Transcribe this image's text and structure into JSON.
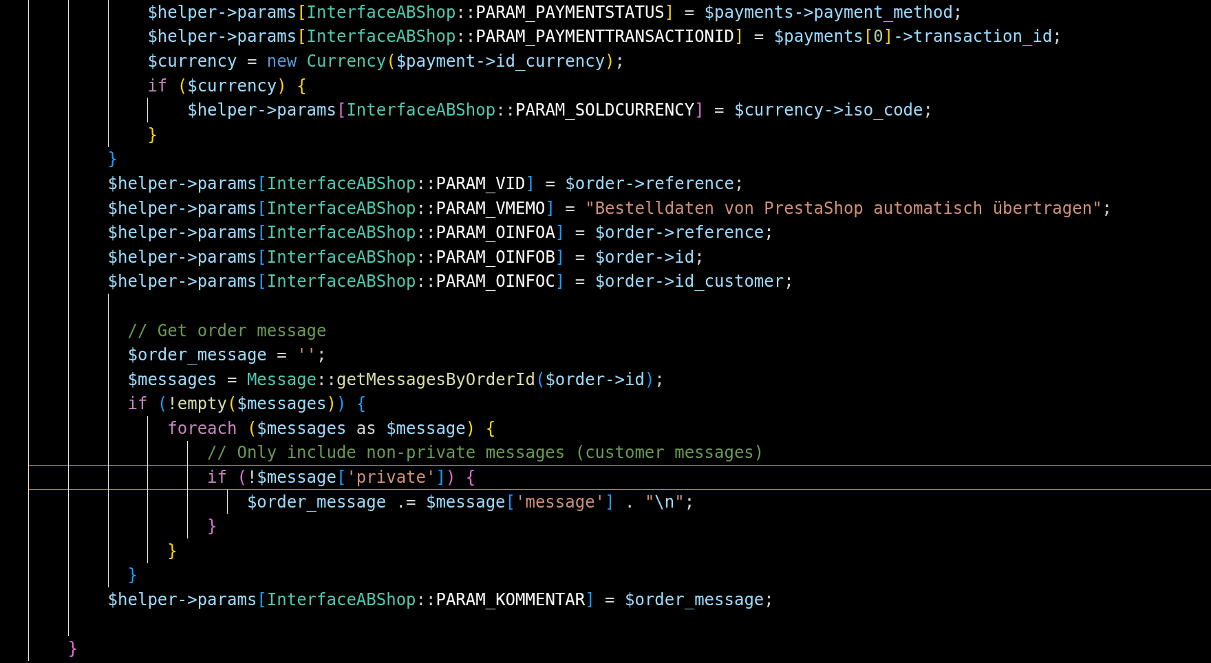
{
  "editor": {
    "lines": [
      {
        "kind": "group",
        "children": [
          {
            "kind": "group",
            "children": [
              {
                "kind": "code",
                "active": false,
                "tokens": [
                  {
                    "kind": "var",
                    "text": "$helper->params"
                  },
                  {
                    "kind": "b1",
                    "text": "["
                  },
                  {
                    "kind": "cls",
                    "text": "InterfaceABShop"
                  },
                  {
                    "kind": "op",
                    "text": "::"
                  },
                  {
                    "kind": "const",
                    "text": "PARAM_PAYMENTSTATUS"
                  },
                  {
                    "kind": "b1",
                    "text": "]"
                  },
                  {
                    "kind": "op",
                    "text": " = "
                  },
                  {
                    "kind": "var",
                    "text": "$payments->payment_method"
                  },
                  {
                    "kind": "op",
                    "text": ";"
                  }
                ]
              },
              {
                "kind": "code",
                "active": false,
                "tokens": [
                  {
                    "kind": "var",
                    "text": "$helper->params"
                  },
                  {
                    "kind": "b1",
                    "text": "["
                  },
                  {
                    "kind": "cls",
                    "text": "InterfaceABShop"
                  },
                  {
                    "kind": "op",
                    "text": "::"
                  },
                  {
                    "kind": "const",
                    "text": "PARAM_PAYMENTTRANSACTIONID"
                  },
                  {
                    "kind": "b1",
                    "text": "]"
                  },
                  {
                    "kind": "op",
                    "text": " = "
                  },
                  {
                    "kind": "var",
                    "text": "$payments"
                  },
                  {
                    "kind": "b1",
                    "text": "["
                  },
                  {
                    "kind": "num",
                    "text": "0"
                  },
                  {
                    "kind": "b1",
                    "text": "]"
                  },
                  {
                    "kind": "var",
                    "text": "->transaction_id"
                  },
                  {
                    "kind": "op",
                    "text": ";"
                  }
                ]
              },
              {
                "kind": "code",
                "active": false,
                "tokens": [
                  {
                    "kind": "var",
                    "text": "$currency"
                  },
                  {
                    "kind": "op",
                    "text": " = "
                  },
                  {
                    "kind": "new",
                    "text": "new "
                  },
                  {
                    "kind": "cls",
                    "text": "Currency"
                  },
                  {
                    "kind": "b1",
                    "text": "("
                  },
                  {
                    "kind": "var",
                    "text": "$payment->id_currency"
                  },
                  {
                    "kind": "b1",
                    "text": ")"
                  },
                  {
                    "kind": "op",
                    "text": ";"
                  }
                ]
              },
              {
                "kind": "code",
                "active": false,
                "tokens": [
                  {
                    "kind": "kw",
                    "text": "if "
                  },
                  {
                    "kind": "b1",
                    "text": "("
                  },
                  {
                    "kind": "var",
                    "text": "$currency"
                  },
                  {
                    "kind": "b1",
                    "text": ") {"
                  }
                ],
                "children": [
                  {
                    "kind": "code",
                    "active": false,
                    "tokens": [
                      {
                        "kind": "var",
                        "text": "$helper->params"
                      },
                      {
                        "kind": "b2",
                        "text": "["
                      },
                      {
                        "kind": "cls",
                        "text": "InterfaceABShop"
                      },
                      {
                        "kind": "op",
                        "text": "::"
                      },
                      {
                        "kind": "const",
                        "text": "PARAM_SOLDCURRENCY"
                      },
                      {
                        "kind": "b2",
                        "text": "]"
                      },
                      {
                        "kind": "op",
                        "text": " = "
                      },
                      {
                        "kind": "var",
                        "text": "$currency->iso_code"
                      },
                      {
                        "kind": "op",
                        "text": ";"
                      }
                    ]
                  }
                ]
              },
              {
                "kind": "code",
                "active": false,
                "tokens": [
                  {
                    "kind": "b1",
                    "text": "}"
                  }
                ]
              }
            ]
          },
          {
            "kind": "code",
            "active": false,
            "tokens": [
              {
                "kind": "b3",
                "text": "}"
              }
            ]
          },
          {
            "kind": "code",
            "active": false,
            "tokens": [
              {
                "kind": "var",
                "text": "$helper->params"
              },
              {
                "kind": "b3",
                "text": "["
              },
              {
                "kind": "cls",
                "text": "InterfaceABShop"
              },
              {
                "kind": "op",
                "text": "::"
              },
              {
                "kind": "const",
                "text": "PARAM_VID"
              },
              {
                "kind": "b3",
                "text": "]"
              },
              {
                "kind": "op",
                "text": " = "
              },
              {
                "kind": "var",
                "text": "$order->reference"
              },
              {
                "kind": "op",
                "text": ";"
              }
            ]
          },
          {
            "kind": "code",
            "active": false,
            "tokens": [
              {
                "kind": "var",
                "text": "$helper->params"
              },
              {
                "kind": "b3",
                "text": "["
              },
              {
                "kind": "cls",
                "text": "InterfaceABShop"
              },
              {
                "kind": "op",
                "text": "::"
              },
              {
                "kind": "const",
                "text": "PARAM_VMEMO"
              },
              {
                "kind": "b3",
                "text": "]"
              },
              {
                "kind": "op",
                "text": " = "
              },
              {
                "kind": "str",
                "text": "\"Bestelldaten von PrestaShop automatisch übertragen\""
              },
              {
                "kind": "op",
                "text": ";"
              }
            ]
          },
          {
            "kind": "code",
            "active": false,
            "tokens": [
              {
                "kind": "var",
                "text": "$helper->params"
              },
              {
                "kind": "b3",
                "text": "["
              },
              {
                "kind": "cls",
                "text": "InterfaceABShop"
              },
              {
                "kind": "op",
                "text": "::"
              },
              {
                "kind": "const",
                "text": "PARAM_OINFOA"
              },
              {
                "kind": "b3",
                "text": "]"
              },
              {
                "kind": "op",
                "text": " = "
              },
              {
                "kind": "var",
                "text": "$order->reference"
              },
              {
                "kind": "op",
                "text": ";"
              }
            ]
          },
          {
            "kind": "code",
            "active": false,
            "tokens": [
              {
                "kind": "var",
                "text": "$helper->params"
              },
              {
                "kind": "b3",
                "text": "["
              },
              {
                "kind": "cls",
                "text": "InterfaceABShop"
              },
              {
                "kind": "op",
                "text": "::"
              },
              {
                "kind": "const",
                "text": "PARAM_OINFOB"
              },
              {
                "kind": "b3",
                "text": "]"
              },
              {
                "kind": "op",
                "text": " = "
              },
              {
                "kind": "var",
                "text": "$order->id"
              },
              {
                "kind": "op",
                "text": ";"
              }
            ]
          },
          {
            "kind": "code",
            "active": false,
            "tokens": [
              {
                "kind": "var",
                "text": "$helper->params"
              },
              {
                "kind": "b3",
                "text": "["
              },
              {
                "kind": "cls",
                "text": "InterfaceABShop"
              },
              {
                "kind": "op",
                "text": "::"
              },
              {
                "kind": "const",
                "text": "PARAM_OINFOC"
              },
              {
                "kind": "b3",
                "text": "]"
              },
              {
                "kind": "op",
                "text": " = "
              },
              {
                "kind": "var",
                "text": "$order->id_customer"
              },
              {
                "kind": "op",
                "text": ";"
              }
            ]
          },
          {
            "kind": "blank"
          },
          {
            "kind": "shifted",
            "active": false,
            "tokens": [
              {
                "kind": "cmt",
                "text": "// Get order message"
              }
            ]
          },
          {
            "kind": "shifted",
            "active": false,
            "tokens": [
              {
                "kind": "var",
                "text": "$order_message"
              },
              {
                "kind": "op",
                "text": " = "
              },
              {
                "kind": "str",
                "text": "''"
              },
              {
                "kind": "op",
                "text": ";"
              }
            ]
          },
          {
            "kind": "shifted",
            "active": false,
            "tokens": [
              {
                "kind": "var",
                "text": "$messages"
              },
              {
                "kind": "op",
                "text": " = "
              },
              {
                "kind": "cls",
                "text": "Message"
              },
              {
                "kind": "op",
                "text": "::"
              },
              {
                "kind": "fn",
                "text": "getMessagesByOrderId"
              },
              {
                "kind": "b3",
                "text": "("
              },
              {
                "kind": "var",
                "text": "$order->id"
              },
              {
                "kind": "b3",
                "text": ")"
              },
              {
                "kind": "op",
                "text": ";"
              }
            ]
          },
          {
            "kind": "shifted",
            "active": false,
            "tokens": [
              {
                "kind": "kw",
                "text": "if "
              },
              {
                "kind": "b3",
                "text": "("
              },
              {
                "kind": "op",
                "text": "!"
              },
              {
                "kind": "fn",
                "text": "empty"
              },
              {
                "kind": "b1",
                "text": "("
              },
              {
                "kind": "var",
                "text": "$messages"
              },
              {
                "kind": "b1",
                "text": ")"
              },
              {
                "kind": "b3",
                "text": ") {"
              }
            ],
            "children": [
              {
                "kind": "code",
                "active": false,
                "tokens": [
                  {
                    "kind": "kw",
                    "text": "foreach "
                  },
                  {
                    "kind": "b1",
                    "text": "("
                  },
                  {
                    "kind": "var",
                    "text": "$messages"
                  },
                  {
                    "kind": "op",
                    "text": " as "
                  },
                  {
                    "kind": "var",
                    "text": "$message"
                  },
                  {
                    "kind": "b1",
                    "text": ") {"
                  }
                ],
                "children": [
                  {
                    "kind": "code",
                    "active": false,
                    "tokens": [
                      {
                        "kind": "cmt",
                        "text": "// Only include non-private messages (customer messages)"
                      }
                    ]
                  },
                  {
                    "kind": "code",
                    "active": true,
                    "tokens": [
                      {
                        "kind": "kw",
                        "text": "if "
                      },
                      {
                        "kind": "b2",
                        "text": "("
                      },
                      {
                        "kind": "op",
                        "text": "!"
                      },
                      {
                        "kind": "var",
                        "text": "$message"
                      },
                      {
                        "kind": "b3",
                        "text": "["
                      },
                      {
                        "kind": "str",
                        "text": "'private'"
                      },
                      {
                        "kind": "b3",
                        "text": "]"
                      },
                      {
                        "kind": "b2",
                        "text": ") {"
                      }
                    ],
                    "children": [
                      {
                        "kind": "code",
                        "active": false,
                        "tokens": [
                          {
                            "kind": "var",
                            "text": "$order_message"
                          },
                          {
                            "kind": "op",
                            "text": " .= "
                          },
                          {
                            "kind": "var",
                            "text": "$message"
                          },
                          {
                            "kind": "b3",
                            "text": "["
                          },
                          {
                            "kind": "str",
                            "text": "'message'"
                          },
                          {
                            "kind": "b3",
                            "text": "]"
                          },
                          {
                            "kind": "op",
                            "text": " . "
                          },
                          {
                            "kind": "str",
                            "text": "\""
                          },
                          {
                            "kind": "esc",
                            "text": "\\n"
                          },
                          {
                            "kind": "str",
                            "text": "\""
                          },
                          {
                            "kind": "op",
                            "text": ";"
                          }
                        ]
                      }
                    ]
                  },
                  {
                    "kind": "code",
                    "active": false,
                    "tokens": [
                      {
                        "kind": "b2",
                        "text": "}"
                      }
                    ]
                  }
                ]
              },
              {
                "kind": "code",
                "active": false,
                "tokens": [
                  {
                    "kind": "b1",
                    "text": "}"
                  }
                ]
              }
            ]
          },
          {
            "kind": "shifted",
            "active": false,
            "tokens": [
              {
                "kind": "b3",
                "text": "}"
              }
            ]
          },
          {
            "kind": "code",
            "active": false,
            "tokens": [
              {
                "kind": "var",
                "text": "$helper->params"
              },
              {
                "kind": "b3",
                "text": "["
              },
              {
                "kind": "cls",
                "text": "InterfaceABShop"
              },
              {
                "kind": "op",
                "text": "::"
              },
              {
                "kind": "const",
                "text": "PARAM_KOMMENTAR"
              },
              {
                "kind": "b3",
                "text": "]"
              },
              {
                "kind": "op",
                "text": " = "
              },
              {
                "kind": "var",
                "text": "$order_message"
              },
              {
                "kind": "op",
                "text": ";"
              }
            ]
          },
          {
            "kind": "blank"
          }
        ]
      },
      {
        "kind": "code",
        "active": false,
        "tokens": [
          {
            "kind": "b2",
            "text": "}"
          }
        ]
      }
    ]
  }
}
